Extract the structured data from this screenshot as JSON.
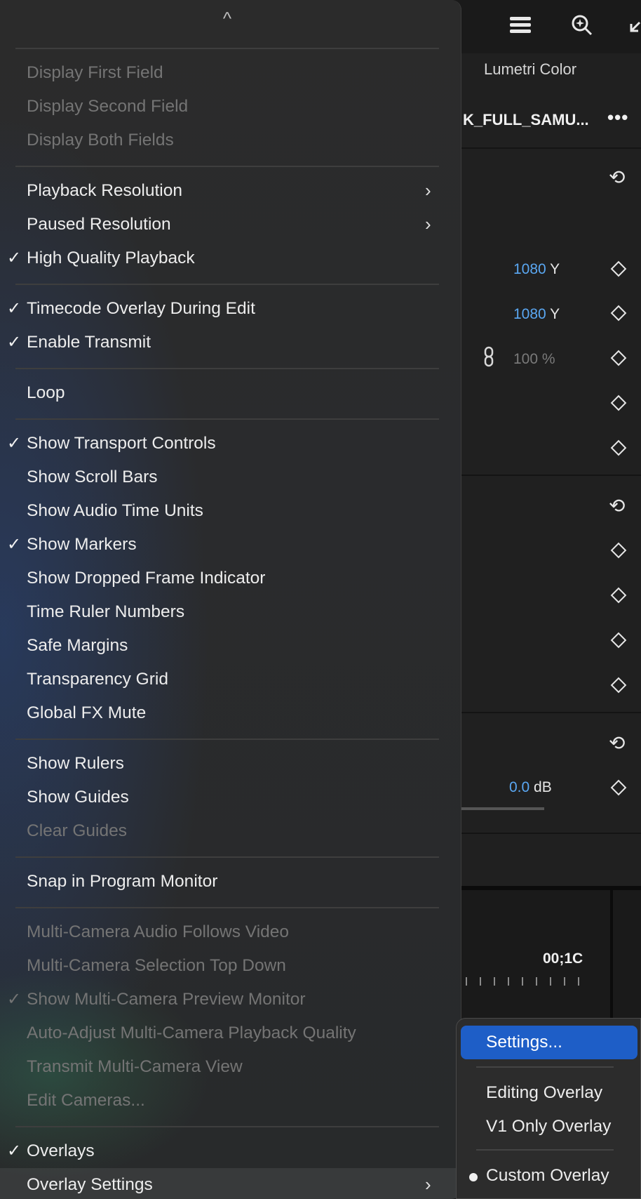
{
  "background": {
    "panel_title": "Lumetri Color",
    "clip_name": "K_FULL_SAMU...",
    "more": "•••",
    "rows": [
      {
        "blue": "1080",
        "suffix": " Y"
      },
      {
        "blue": "1080",
        "suffix": " Y"
      },
      {
        "value": "100 %"
      }
    ],
    "audio_value": {
      "blue": "0.0",
      "suffix": " dB"
    },
    "timecode": "00;1C"
  },
  "menu": {
    "groups": [
      [
        {
          "label": "Display First Field",
          "checked": false,
          "disabled": true,
          "submenu": false
        },
        {
          "label": "Display Second Field",
          "checked": false,
          "disabled": true,
          "submenu": false
        },
        {
          "label": "Display Both Fields",
          "checked": false,
          "disabled": true,
          "submenu": false
        }
      ],
      [
        {
          "label": "Playback Resolution",
          "checked": false,
          "disabled": false,
          "submenu": true
        },
        {
          "label": "Paused Resolution",
          "checked": false,
          "disabled": false,
          "submenu": true
        },
        {
          "label": "High Quality Playback",
          "checked": true,
          "disabled": false,
          "submenu": false
        }
      ],
      [
        {
          "label": "Timecode Overlay During Edit",
          "checked": true,
          "disabled": false,
          "submenu": false
        },
        {
          "label": "Enable Transmit",
          "checked": true,
          "disabled": false,
          "submenu": false
        }
      ],
      [
        {
          "label": "Loop",
          "checked": false,
          "disabled": false,
          "submenu": false
        }
      ],
      [
        {
          "label": "Show Transport Controls",
          "checked": true,
          "disabled": false,
          "submenu": false
        },
        {
          "label": "Show Scroll Bars",
          "checked": false,
          "disabled": false,
          "submenu": false
        },
        {
          "label": "Show Audio Time Units",
          "checked": false,
          "disabled": false,
          "submenu": false
        },
        {
          "label": "Show Markers",
          "checked": true,
          "disabled": false,
          "submenu": false
        },
        {
          "label": "Show Dropped Frame Indicator",
          "checked": false,
          "disabled": false,
          "submenu": false
        },
        {
          "label": "Time Ruler Numbers",
          "checked": false,
          "disabled": false,
          "submenu": false
        },
        {
          "label": "Safe Margins",
          "checked": false,
          "disabled": false,
          "submenu": false
        },
        {
          "label": "Transparency Grid",
          "checked": false,
          "disabled": false,
          "submenu": false
        },
        {
          "label": "Global FX Mute",
          "checked": false,
          "disabled": false,
          "submenu": false
        }
      ],
      [
        {
          "label": "Show Rulers",
          "checked": false,
          "disabled": false,
          "submenu": false
        },
        {
          "label": "Show Guides",
          "checked": false,
          "disabled": false,
          "submenu": false
        },
        {
          "label": "Clear Guides",
          "checked": false,
          "disabled": true,
          "submenu": false
        }
      ],
      [
        {
          "label": "Snap in Program Monitor",
          "checked": false,
          "disabled": false,
          "submenu": false
        }
      ],
      [
        {
          "label": "Multi-Camera Audio Follows Video",
          "checked": false,
          "disabled": true,
          "submenu": false
        },
        {
          "label": "Multi-Camera Selection Top Down",
          "checked": false,
          "disabled": true,
          "submenu": false
        },
        {
          "label": "Show Multi-Camera Preview Monitor",
          "checked": true,
          "disabled": true,
          "submenu": false
        },
        {
          "label": "Auto-Adjust Multi-Camera Playback Quality",
          "checked": false,
          "disabled": true,
          "submenu": false
        },
        {
          "label": "Transmit Multi-Camera View",
          "checked": false,
          "disabled": true,
          "submenu": false
        },
        {
          "label": "Edit Cameras...",
          "checked": false,
          "disabled": true,
          "submenu": false
        }
      ],
      [
        {
          "label": "Overlays",
          "checked": true,
          "disabled": false,
          "submenu": false
        },
        {
          "label": "Overlay Settings",
          "checked": false,
          "disabled": false,
          "submenu": true,
          "hover": true
        }
      ]
    ]
  },
  "submenu": {
    "settings": "Settings...",
    "editing_overlay": "Editing Overlay",
    "v1_only_overlay": "V1 Only Overlay",
    "custom_overlay": "Custom Overlay",
    "selected_color": "#1e5ec7"
  },
  "glyphs": {
    "check": "✓",
    "arrow": "›",
    "scroll_up": "^"
  }
}
